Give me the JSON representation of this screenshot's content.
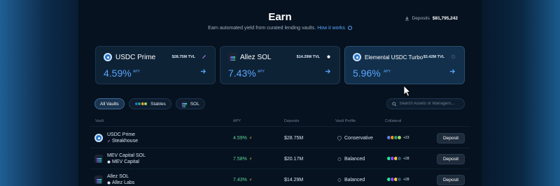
{
  "header": {
    "title": "Earn",
    "subtitle": "Earn automated yield from curated lending vaults.",
    "how_it_works": "How it works",
    "deposits_label": "Deposits",
    "deposits_value": "$81,795,242"
  },
  "featured": [
    {
      "name": "USDC Prime",
      "tvl": "$28.75M TVL",
      "apy": "4.59%",
      "apy_label": "APY",
      "icon": "usdc-icon"
    },
    {
      "name": "Allez SOL",
      "tvl": "$14.29M TVL",
      "apy": "7.43%",
      "apy_label": "APY",
      "icon": "sol-icon"
    },
    {
      "name": "Elemental USDC Turbo",
      "tvl": "$3.42M TVL",
      "apy": "5.96%",
      "apy_label": "APY",
      "icon": "usdc-icon"
    }
  ],
  "filters": {
    "all": "All Vaults",
    "stables": "Stables",
    "sol": "SOL",
    "search_placeholder": "Search Assets or Managers..."
  },
  "table": {
    "headers": {
      "vault": "Vault",
      "apy": "APY",
      "deposits": "Deposits",
      "profile": "Vault Profile",
      "collateral": "Collateral"
    },
    "deposit_label": "Deposit",
    "rows": [
      {
        "name": "USDC Prime",
        "curator": "Steakhouse",
        "apy": "4.59%",
        "deposits": "$28.75M",
        "profile": "Conservative",
        "more": "+23",
        "icon": "usdc-icon"
      },
      {
        "name": "MEV Capital SOL",
        "curator": "MEV Capital",
        "apy": "7.58%",
        "deposits": "$20.17M",
        "profile": "Balanced",
        "more": "+28",
        "icon": "sol-icon"
      },
      {
        "name": "Allez SOL",
        "curator": "Allez Labs",
        "apy": "7.43%",
        "deposits": "$14.29M",
        "profile": "Balanced",
        "more": "+28",
        "icon": "sol-icon"
      }
    ]
  },
  "colors": {
    "accent": "#5aa6ff",
    "apy_green": "#5fd39a",
    "background": "#06121f",
    "card": "#0e2236"
  }
}
